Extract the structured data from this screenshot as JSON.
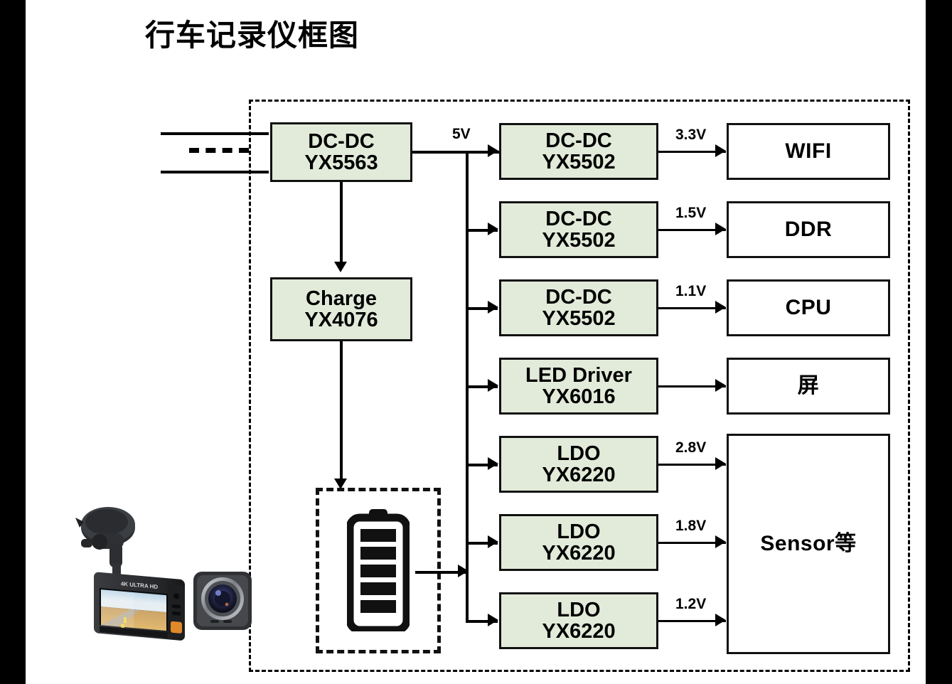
{
  "page": {
    "title": "行车记录仪框图",
    "background": "#ffffff",
    "frame_color": "#000000",
    "ic_fill": "#e2ebd9",
    "load_fill": "#ffffff",
    "line_color": "#000000"
  },
  "input": {
    "label_dashes": "- - -"
  },
  "primary": {
    "name": "DC-DC",
    "part": "YX5563",
    "output_label": "5V"
  },
  "charger": {
    "name": "Charge",
    "part": "YX4076"
  },
  "battery": {
    "icon": "battery-full-icon",
    "cells": 5
  },
  "product_photo": {
    "icon": "dashcam-photo",
    "brand_text": "4K ULTRA HD"
  },
  "rails": [
    {
      "regulator_name": "DC-DC",
      "regulator_part": "YX5502",
      "voltage": "3.3V",
      "load": "WIFI"
    },
    {
      "regulator_name": "DC-DC",
      "regulator_part": "YX5502",
      "voltage": "1.5V",
      "load": "DDR"
    },
    {
      "regulator_name": "DC-DC",
      "regulator_part": "YX5502",
      "voltage": "1.1V",
      "load": "CPU"
    },
    {
      "regulator_name": "LED Driver",
      "regulator_part": "YX6016",
      "voltage": "",
      "load": "屏"
    },
    {
      "regulator_name": "LDO",
      "regulator_part": "YX6220",
      "voltage": "2.8V",
      "load": ""
    },
    {
      "regulator_name": "LDO",
      "regulator_part": "YX6220",
      "voltage": "1.8V",
      "load": ""
    },
    {
      "regulator_name": "LDO",
      "regulator_part": "YX6220",
      "voltage": "1.2V",
      "load": ""
    }
  ],
  "sensor_block": {
    "label": "Sensor等"
  }
}
